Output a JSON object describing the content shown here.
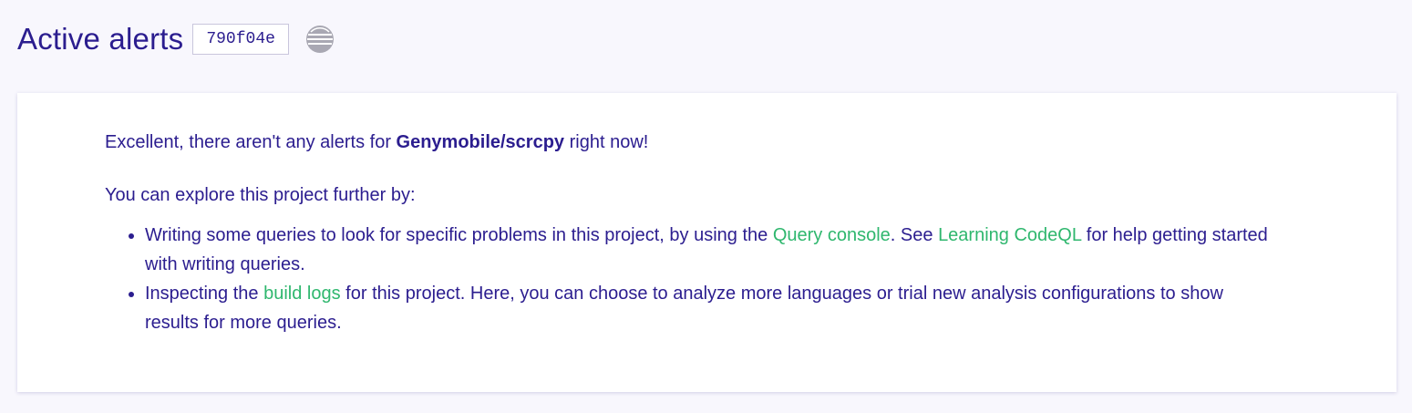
{
  "header": {
    "title": "Active alerts",
    "commit": "790f04e",
    "language_icon": "c-language-icon"
  },
  "message": {
    "intro_prefix": "Excellent, there aren't any alerts for ",
    "project": "Genymobile/scrcpy",
    "intro_suffix": " right now!",
    "explore": "You can explore this project further by:"
  },
  "items": [
    {
      "t1": "Writing some queries to look for specific problems in this project, by using the ",
      "link1": "Query console",
      "t2": ". See ",
      "link2": "Learning CodeQL",
      "t3": " for help getting started with writing queries."
    },
    {
      "t1": "Inspecting the ",
      "link1": "build logs",
      "t2": " for this project. Here, you can choose to analyze more languages or trial new analysis configurations to show results for more queries."
    }
  ],
  "colors": {
    "text": "#2b1d8f",
    "link": "#2fb76e",
    "background": "#f8f7fd"
  }
}
